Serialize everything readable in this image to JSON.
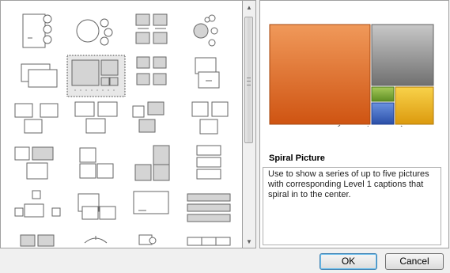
{
  "gallery": {
    "selected_index": 5,
    "items": [
      "vertical-circle-list-icon",
      "circle-arrow-process-icon",
      "picture-grid-icon",
      "radial-cluster-icon",
      "picture-stack-icon",
      "spiral-picture-icon",
      "bending-picture-caption-icon",
      "picture-caption-list-icon",
      "framed-picture-grid-icon",
      "picture-accent-blocks-icon",
      "snapshot-picture-list-icon",
      "picture-tabs-icon",
      "picture-strips-icon",
      "title-picture-lineup-icon",
      "picture-blocks-icon",
      "picture-list-icon",
      "circular-picture-callout-icon",
      "ascending-picture-accent-icon",
      "titled-picture-blocks-icon",
      "horizontal-picture-list-icon",
      "hierarchy-picture-icon",
      "picture-accent-process-icon",
      "continuous-picture-icon",
      "table-list-icon"
    ]
  },
  "preview": {
    "colors": {
      "orange": "#e8691f",
      "gray": "#8c8c8c",
      "green": "#7caa2e",
      "blue": "#3a68c8",
      "yellow": "#f3b31b"
    }
  },
  "info": {
    "title": "Spiral Picture",
    "description": "Use to show a series of up to five pictures with corresponding Level 1 captions that spiral in to the center."
  },
  "buttons": {
    "ok": "OK",
    "cancel": "Cancel"
  }
}
